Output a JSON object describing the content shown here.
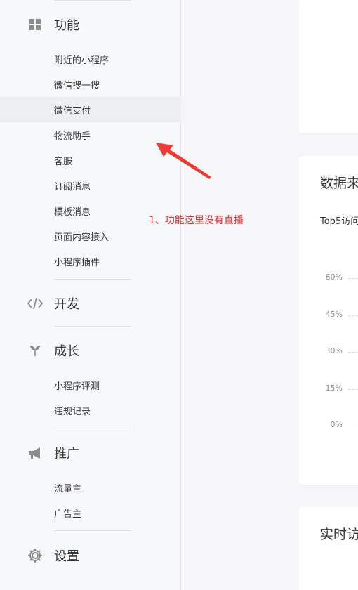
{
  "sidebar": {
    "sections": {
      "function": {
        "label": "功能",
        "icon": "grid-icon"
      },
      "develop": {
        "label": "开发",
        "icon": "code-icon"
      },
      "growth": {
        "label": "成长",
        "icon": "sprout-icon"
      },
      "promote": {
        "label": "推广",
        "icon": "megaphone-icon"
      },
      "settings": {
        "label": "设置",
        "icon": "gear-icon"
      }
    },
    "function_items": [
      {
        "label": "附近的小程序"
      },
      {
        "label": "微信搜一搜"
      },
      {
        "label": "微信支付"
      },
      {
        "label": "物流助手"
      },
      {
        "label": "客服"
      },
      {
        "label": "订阅消息"
      },
      {
        "label": "模板消息"
      },
      {
        "label": "页面内容接入"
      },
      {
        "label": "小程序插件"
      }
    ],
    "growth_items": [
      {
        "label": "小程序评测"
      },
      {
        "label": "违规记录"
      }
    ],
    "promote_items": [
      {
        "label": "流量主"
      },
      {
        "label": "广告主"
      }
    ]
  },
  "main": {
    "data_source_card": {
      "title": "数据来",
      "subtitle": "Top5访问",
      "y_ticks": [
        "60%",
        "45%",
        "30%",
        "15%",
        "0%"
      ]
    },
    "realtime_card": {
      "title": "实时访"
    }
  },
  "annotation": {
    "text": "1、功能这里没有直播",
    "color": "#e0302d"
  },
  "colors": {
    "sidebar_bg": "#f7f8fa",
    "active_item_bg": "#eeeff1",
    "page_bg": "#f6f6f8"
  }
}
